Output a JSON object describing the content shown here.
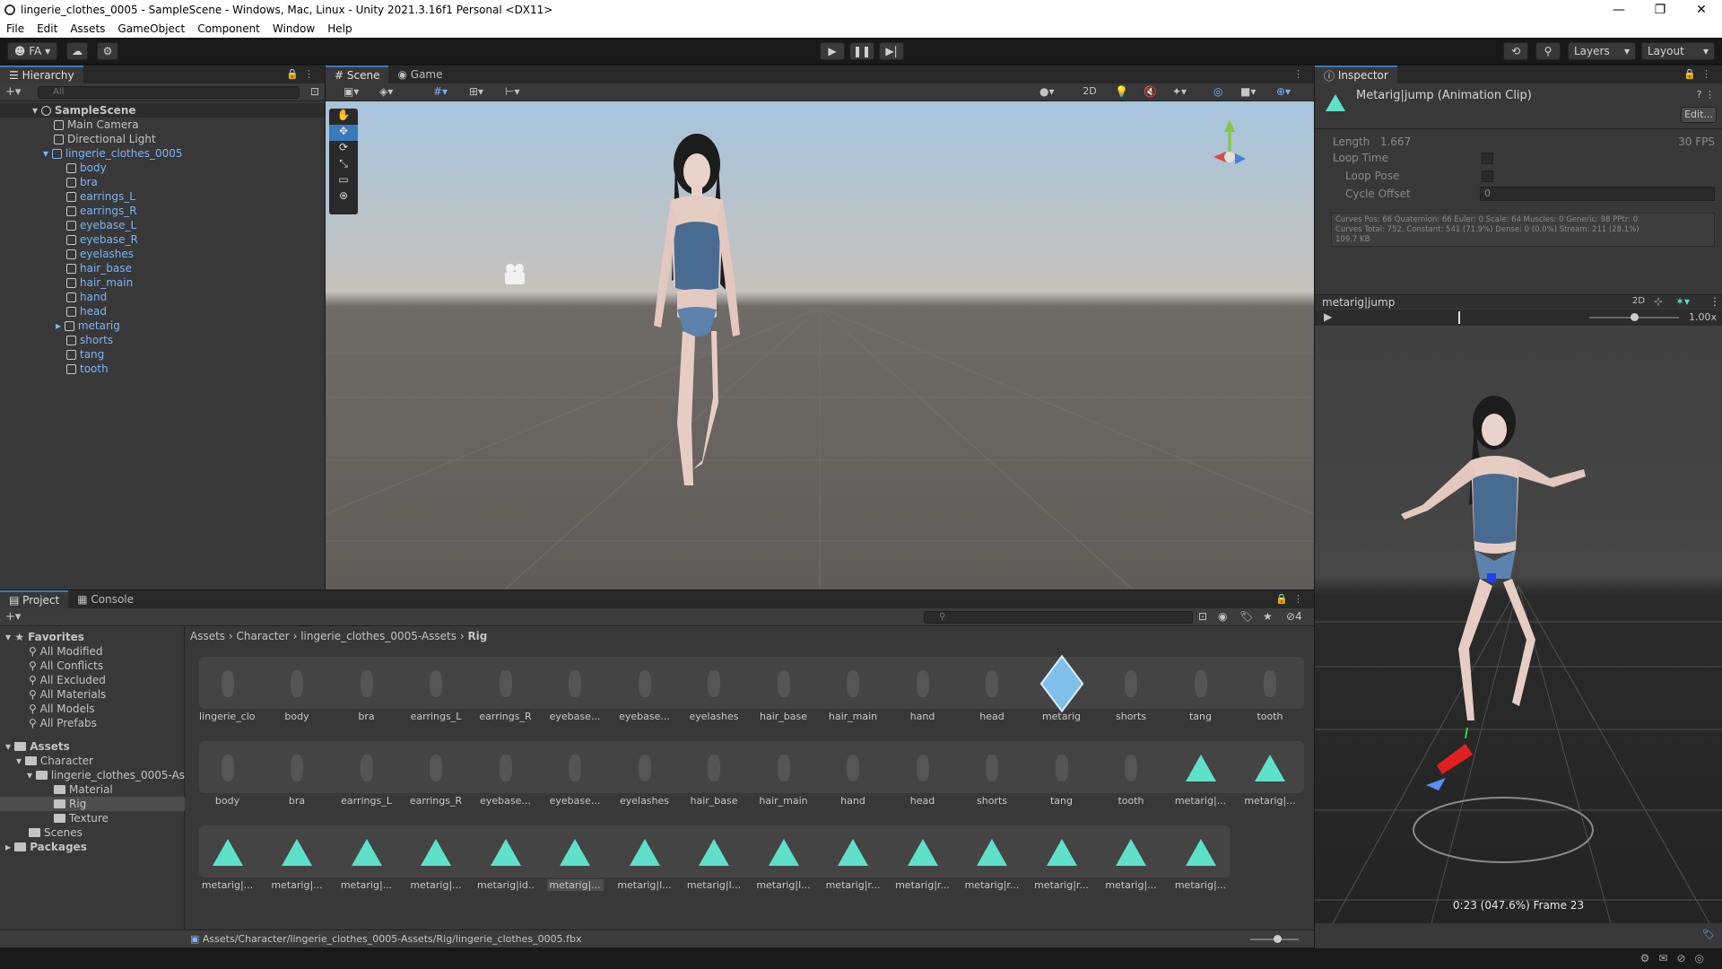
{
  "window": {
    "title": "lingerie_clothes_0005 - SampleScene - Windows, Mac, Linux - Unity 2021.3.16f1 Personal <DX11>"
  },
  "menu": [
    "File",
    "Edit",
    "Assets",
    "GameObject",
    "Component",
    "Window",
    "Help"
  ],
  "toolbar": {
    "account": "FA",
    "layers": "Layers",
    "layout": "Layout"
  },
  "hierarchy": {
    "tab": "Hierarchy",
    "search_placeholder": "All",
    "scene": "SampleScene",
    "items": [
      "Main Camera",
      "Directional Light",
      "lingerie_clothes_0005",
      "body",
      "bra",
      "earrings_L",
      "earrings_R",
      "eyebase_L",
      "eyebase_R",
      "eyelashes",
      "hair_base",
      "hair_main",
      "hand",
      "head",
      "metarig",
      "shorts",
      "tang",
      "tooth"
    ]
  },
  "scene": {
    "tab_scene": "Scene",
    "tab_game": "Game",
    "mode_2d": "2D"
  },
  "inspector": {
    "tab": "Inspector",
    "title": "Metarig|jump (Animation Clip)",
    "edit": "Edit...",
    "length_label": "Length",
    "length_value": "1.667",
    "fps": "30 FPS",
    "loop_time": "Loop Time",
    "loop_pose": "Loop Pose",
    "cycle_offset": "Cycle Offset",
    "cycle_offset_value": "0",
    "curves1": "Curves Pos: 66 Quaternion: 66 Euler: 0 Scale: 64 Muscles: 0 Generic: 98 PPtr: 0",
    "curves2": "Curves Total: 752, Constant: 541 (71.9%) Dense: 0 (0.0%) Stream: 211 (28.1%)",
    "curves3": "109.7 KB",
    "preview_name": "metarig|jump",
    "preview_2d": "2D",
    "speed": "1.00x",
    "timecode": "0:23 (047.6%) Frame 23"
  },
  "project": {
    "tab_project": "Project",
    "tab_console": "Console",
    "count": "4",
    "favorites": "Favorites",
    "fav_items": [
      "All Modified",
      "All Conflicts",
      "All Excluded",
      "All Materials",
      "All Models",
      "All Prefabs"
    ],
    "assets": "Assets",
    "tree": [
      "Character",
      "lingerie_clothes_0005-As",
      "Material",
      "Rig",
      "Texture",
      "Scenes"
    ],
    "packages": "Packages",
    "breadcrumb": [
      "Assets",
      "Character",
      "lingerie_clothes_0005-Assets",
      "Rig"
    ],
    "row1": [
      "lingerie_clo...",
      "body",
      "bra",
      "earrings_L",
      "earrings_R",
      "eyebase...",
      "eyebase...",
      "eyelashes",
      "hair_base",
      "hair_main",
      "hand",
      "head",
      "metarig",
      "shorts",
      "tang",
      "tooth"
    ],
    "row2": [
      "body",
      "bra",
      "earrings_L",
      "earrings_R",
      "eyebase...",
      "eyebase...",
      "eyelashes",
      "hair_base",
      "hair_main",
      "hand",
      "head",
      "shorts",
      "tang",
      "tooth",
      "metarig|...",
      "metarig|..."
    ],
    "row3": [
      "metarig|...",
      "metarig|...",
      "metarig|...",
      "metarig|...",
      "metarig|id...",
      "metarig|...",
      "metarig|l...",
      "metarig|l...",
      "metarig|l...",
      "metarig|r...",
      "metarig|r...",
      "metarig|r...",
      "metarig|r...",
      "metarig|...",
      "metarig|..."
    ],
    "path": "Assets/Character/lingerie_clothes_0005-Assets/Rig/lingerie_clothes_0005.fbx"
  }
}
